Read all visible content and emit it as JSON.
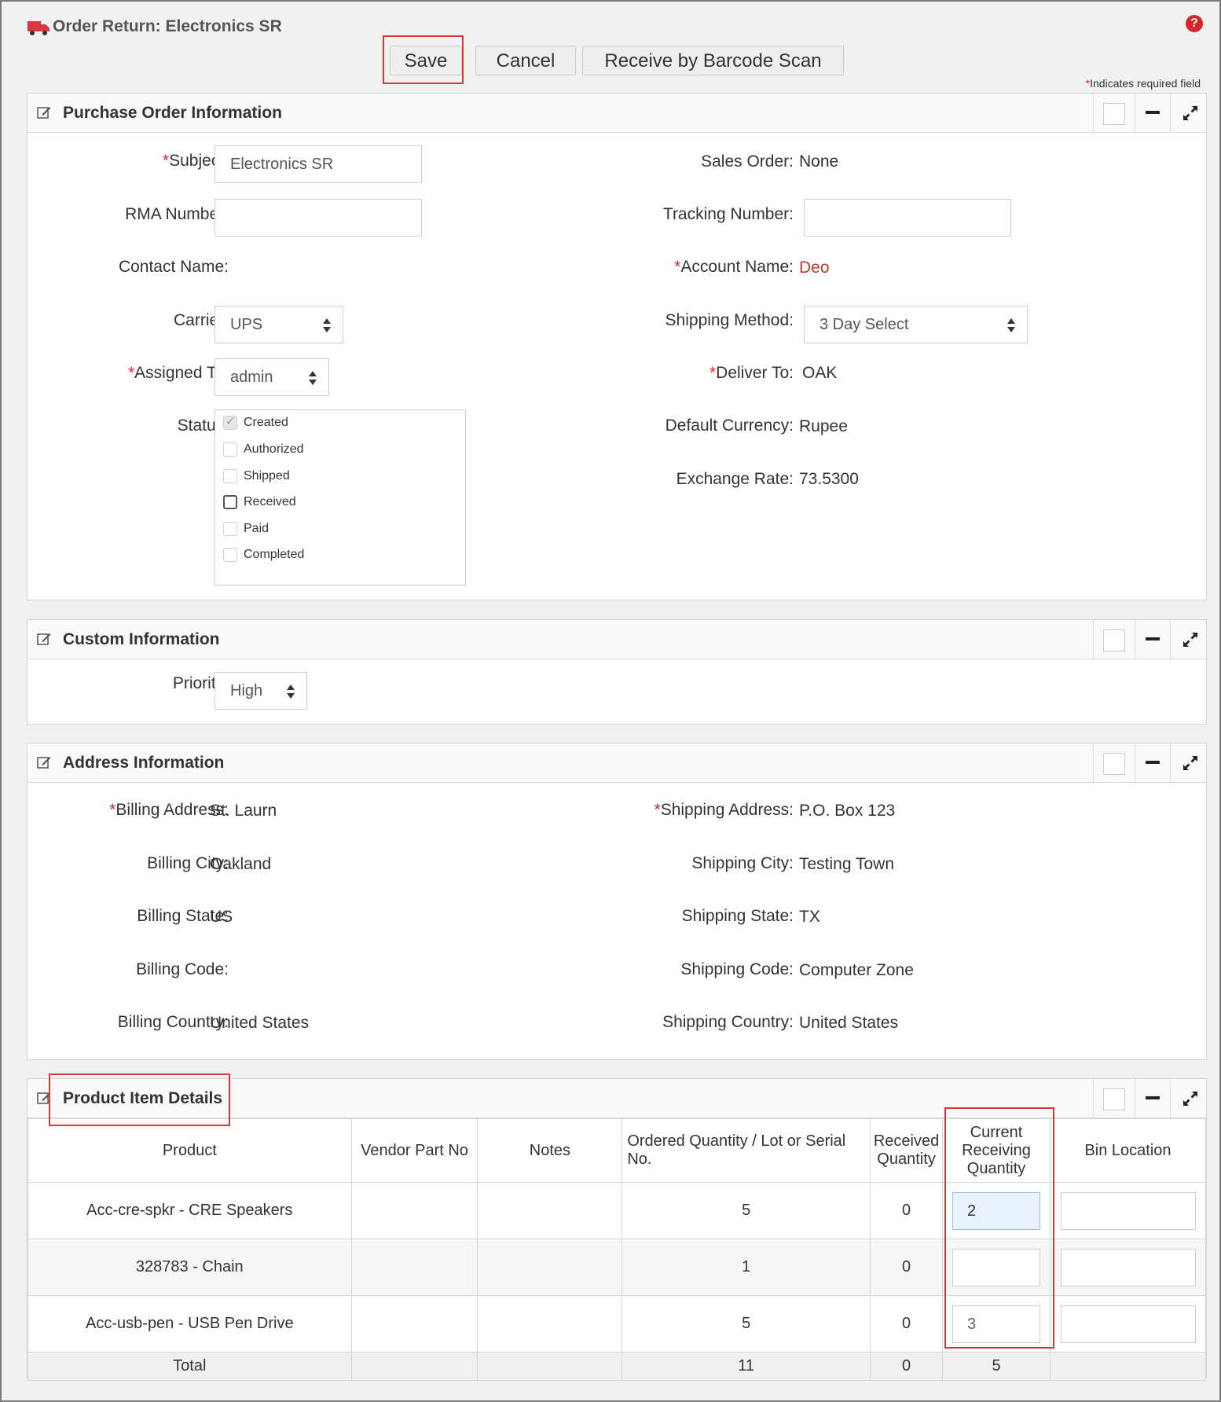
{
  "header": {
    "title": "Order Return: Electronics SR",
    "save_label": "Save",
    "cancel_label": "Cancel",
    "barcode_label": "Receive by Barcode Scan",
    "required_star": "*",
    "required_note": "Indicates required field"
  },
  "purchase_order": {
    "section_title": "Purchase Order Information",
    "subject_label": "Subject:",
    "subject_value": "Electronics SR",
    "rma_label": "RMA Number:",
    "rma_value": "",
    "contact_label": "Contact Name:",
    "carrier_label": "Carrier:",
    "carrier_value": "UPS",
    "assigned_label": "Assigned To:",
    "assigned_value": "admin",
    "status_label": "Status:",
    "status_options": [
      {
        "label": "Created",
        "checked": true
      },
      {
        "label": "Authorized",
        "checked": false
      },
      {
        "label": "Shipped",
        "checked": false
      },
      {
        "label": "Received",
        "checked": false
      },
      {
        "label": "Paid",
        "checked": false
      },
      {
        "label": "Completed",
        "checked": false
      }
    ],
    "sales_order_label": "Sales Order:",
    "sales_order_value": "None",
    "tracking_label": "Tracking Number:",
    "tracking_value": "",
    "account_label": "Account Name:",
    "account_value": "Deo",
    "shipping_method_label": "Shipping Method:",
    "shipping_method_value": "3 Day Select",
    "deliver_label": "Deliver To:",
    "deliver_value": "OAK",
    "currency_label": "Default Currency:",
    "currency_value": "Rupee",
    "exchange_label": "Exchange Rate:",
    "exchange_value": "73.5300"
  },
  "custom": {
    "section_title": "Custom Information",
    "priority_label": "Priority:",
    "priority_value": "High"
  },
  "address": {
    "section_title": "Address Information",
    "billing_address_label": "Billing Address:",
    "billing_address_value": "St. Laurn",
    "billing_city_label": "Billing City:",
    "billing_city_value": "Oakland",
    "billing_state_label": "Billing State:",
    "billing_state_value": "US",
    "billing_code_label": "Billing Code:",
    "billing_code_value": "",
    "billing_country_label": "Billing Country:",
    "billing_country_value": "United States",
    "shipping_address_label": "Shipping Address:",
    "shipping_address_value": "P.O. Box 123",
    "shipping_city_label": "Shipping City:",
    "shipping_city_value": "Testing Town",
    "shipping_state_label": "Shipping State:",
    "shipping_state_value": "TX",
    "shipping_code_label": "Shipping Code:",
    "shipping_code_value": "Computer Zone",
    "shipping_country_label": "Shipping Country:",
    "shipping_country_value": "United States"
  },
  "products": {
    "section_title": "Product Item Details",
    "columns": [
      "Product",
      "Vendor Part No",
      "Notes",
      "Ordered Quantity / Lot or Serial No.",
      "Received Quantity",
      "Current Receiving Quantity",
      "Bin Location"
    ],
    "rows": [
      {
        "product": "Acc-cre-spkr - CRE Speakers",
        "vendor_part": "",
        "notes": "",
        "ordered": "5",
        "received": "0",
        "current": "2",
        "bin": ""
      },
      {
        "product": "328783 - Chain",
        "vendor_part": "",
        "notes": "",
        "ordered": "1",
        "received": "0",
        "current": "",
        "bin": ""
      },
      {
        "product": "Acc-usb-pen - USB Pen Drive",
        "vendor_part": "",
        "notes": "",
        "ordered": "5",
        "received": "0",
        "current": "3",
        "bin": ""
      }
    ],
    "total": {
      "label": "Total",
      "ordered": "11",
      "received": "0",
      "current": "5"
    }
  },
  "colors": {
    "required": "#d9242a",
    "highlight": "#d9363e",
    "account_link": "#c0392b"
  },
  "icons": [
    "truck-icon",
    "help-icon",
    "edit-icon",
    "minimize-icon",
    "expand-icon",
    "select-arrows-icon"
  ]
}
